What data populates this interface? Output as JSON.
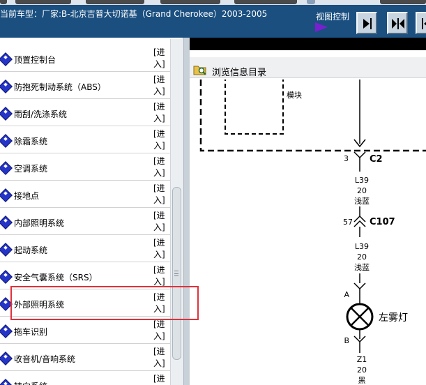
{
  "header": {
    "vehicle_label": "当前车型：厂家:B-北京吉普大切诺基（Grand Cherokee）2003-2005",
    "view_control_label": "视图控制",
    "buttons": [
      {
        "icon": "right-arrow-to-line-icon"
      },
      {
        "icon": "left-right-arrows-icon"
      },
      {
        "icon": "left-arrow-from-line-icon"
      }
    ]
  },
  "system_list": {
    "enter_label": "[进入]",
    "selected_index": 9,
    "selection_color": "#e0313a",
    "items": [
      {
        "label": "顶置控制台"
      },
      {
        "label": "防抱死制动系统（ABS）"
      },
      {
        "label": "雨刮/洗涤系统"
      },
      {
        "label": "除霜系统"
      },
      {
        "label": "空调系统"
      },
      {
        "label": "接地点"
      },
      {
        "label": "内部照明系统"
      },
      {
        "label": "起动系统"
      },
      {
        "label": "安全气囊系统（SRS）"
      },
      {
        "label": "外部照明系统"
      },
      {
        "label": "拖车识别"
      },
      {
        "label": "收音机/音响系统"
      },
      {
        "label": "转向系统"
      }
    ]
  },
  "viewer": {
    "toolbar_label": "浏览信息目录",
    "diagram": {
      "module_text": "模块",
      "connector_c2": {
        "pin": "3",
        "name": "C2"
      },
      "wire_top": {
        "circuit": "L39",
        "gauge": "20",
        "color": "浅蓝"
      },
      "connector_c107": {
        "pin": "57",
        "name": "C107"
      },
      "wire_mid": {
        "circuit": "L39",
        "gauge": "20",
        "color": "浅蓝"
      },
      "lamp": {
        "pin_a": "A",
        "pin_b": "B",
        "label": "左雾灯"
      },
      "wire_bottom": {
        "circuit": "Z1",
        "gauge": "20",
        "color": "黑"
      }
    }
  }
}
